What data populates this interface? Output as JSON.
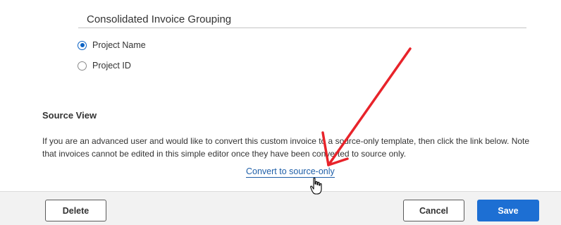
{
  "grouping": {
    "title": "Consolidated Invoice Grouping",
    "options": [
      {
        "label": "Project Name",
        "selected": true
      },
      {
        "label": "Project ID",
        "selected": false
      }
    ]
  },
  "source_view": {
    "heading": "Source View",
    "description": "If you are an advanced user and would like to convert this custom invoice to a source-only template, then click the link below. Note that invoices cannot be edited in this simple editor once they have been converted to source only.",
    "link_label": "Convert to source-only"
  },
  "footer": {
    "delete_label": "Delete",
    "cancel_label": "Cancel",
    "save_label": "Save"
  },
  "colors": {
    "primary": "#1d6fd3",
    "link": "#1f5fa8",
    "annotation_arrow": "#e8232a"
  },
  "icons": [
    "radio-selected-icon",
    "radio-unselected-icon",
    "hand-cursor-icon",
    "annotation-arrow-icon"
  ]
}
